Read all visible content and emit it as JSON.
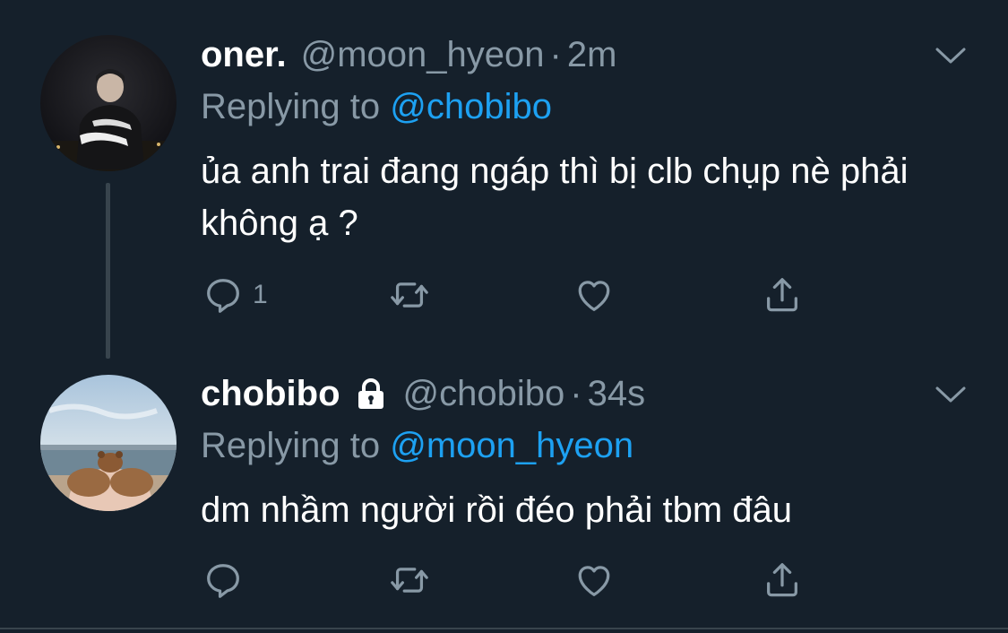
{
  "tweets": [
    {
      "display_name": "oner.",
      "handle": "@moon_hyeon",
      "separator": "·",
      "time": "2m",
      "replying_prefix": "Replying to",
      "replying_to": "@chobibo",
      "text": "ủa anh trai đang ngáp thì bị clb chụp nè phải không ạ ?",
      "reply_count": "1",
      "protected": false
    },
    {
      "display_name": "chobibo",
      "handle": "@chobibo",
      "separator": "·",
      "time": "34s",
      "replying_prefix": "Replying to",
      "replying_to": "@moon_hyeon",
      "text": "dm nhầm người rồi đéo phải tbm đâu",
      "reply_count": "",
      "protected": true
    }
  ],
  "icons": {
    "reply": "reply-icon",
    "retweet": "retweet-icon",
    "like": "heart-icon",
    "share": "share-icon",
    "caret": "chevron-down-icon",
    "lock": "lock-icon"
  },
  "colors": {
    "background": "#15202b",
    "secondary_text": "#8899a6",
    "link": "#1da1f2",
    "thread_line": "#38444d"
  }
}
